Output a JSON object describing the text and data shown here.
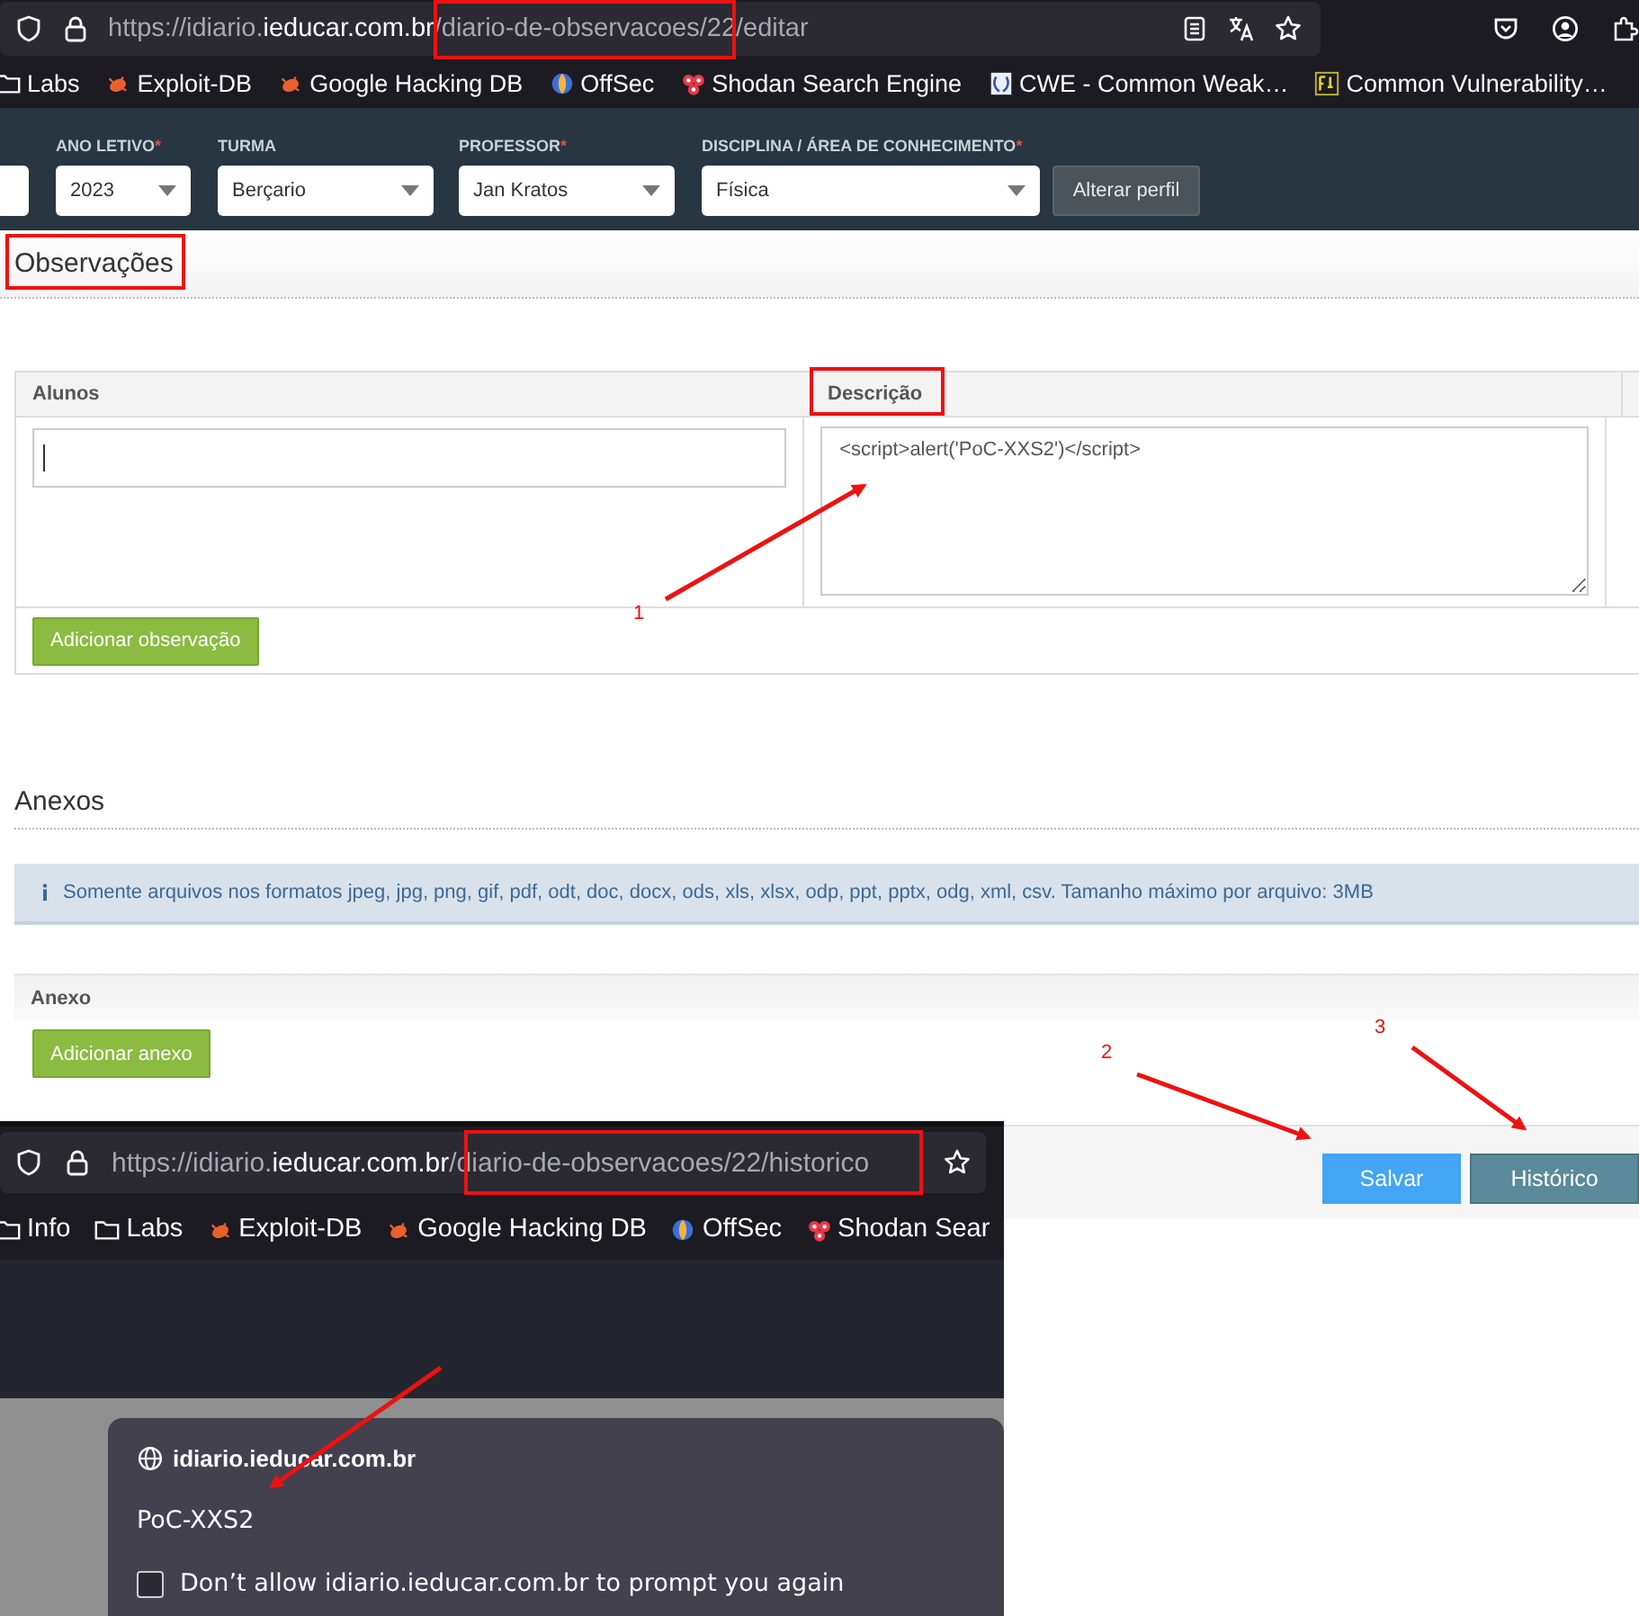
{
  "browser": {
    "url": {
      "prefix": "https://idiario.",
      "domain": "ieducar.com.br",
      "path": "/diario-de-observacoes/22/editar"
    },
    "bookmarks": [
      {
        "kind": "folder",
        "label": "Labs"
      },
      {
        "kind": "bug",
        "label": "Exploit-DB"
      },
      {
        "kind": "bug",
        "label": "Google Hacking DB"
      },
      {
        "kind": "globe",
        "label": "OffSec"
      },
      {
        "kind": "dots",
        "label": "Shodan Search Engine"
      },
      {
        "kind": "page",
        "label": "CWE - Common Weak…"
      },
      {
        "kind": "badge",
        "label": "Common Vulnerability…"
      }
    ]
  },
  "filters": [
    {
      "label": "ANO LETIVO",
      "marker": "*",
      "value": "2023"
    },
    {
      "label": "TURMA",
      "value": "Berçario"
    },
    {
      "label": "PROFESSOR",
      "marker": "*",
      "value": "Jan Kratos"
    },
    {
      "label": "DISCIPLINA / ÁREA DE CONHECIMENTO",
      "marker": "*",
      "value": "Física"
    }
  ],
  "profile_button": "Alterar perfil",
  "observacoes": {
    "title": "Observações",
    "columns": [
      "Alunos",
      "Descrição"
    ],
    "description_value": "<script>alert('PoC-XXS2')</script>",
    "add_button": "Adicionar observação"
  },
  "anexos": {
    "title": "Anexos",
    "info": "Somente arquivos nos formatos jpeg, jpg, png, gif, pdf, odt, doc, docx, ods, xls, xlsx, odp, ppt, pptx, odg, xml, csv. Tamanho máximo por arquivo: 3MB",
    "column": "Anexo",
    "add_button": "Adicionar anexo"
  },
  "footer_buttons": [
    {
      "kind": "primary",
      "label": "Salvar"
    },
    {
      "kind": "secondary",
      "label": "Histórico"
    }
  ],
  "second_browser": {
    "url": {
      "prefix": "https://idiario.",
      "domain": "ieducar.com.br",
      "path": "/diario-de-observacoes/22/historico"
    },
    "bookmarks": [
      {
        "kind": "folder",
        "label": "Info"
      },
      {
        "kind": "folder",
        "label": "Labs"
      },
      {
        "kind": "bug",
        "label": "Exploit-DB"
      },
      {
        "kind": "bug",
        "label": "Google Hacking DB"
      },
      {
        "kind": "globe",
        "label": "OffSec"
      },
      {
        "kind": "dots",
        "label": "Shodan Sear"
      }
    ],
    "dialog": {
      "host": "idiario.ieducar.com.br",
      "message": "PoC-XXS2",
      "checkbox_label": "Don’t allow idiario.ieducar.com.br to prompt you again",
      "checked": false
    }
  },
  "annotations": {
    "labels": [
      "1",
      "2",
      "3"
    ]
  }
}
